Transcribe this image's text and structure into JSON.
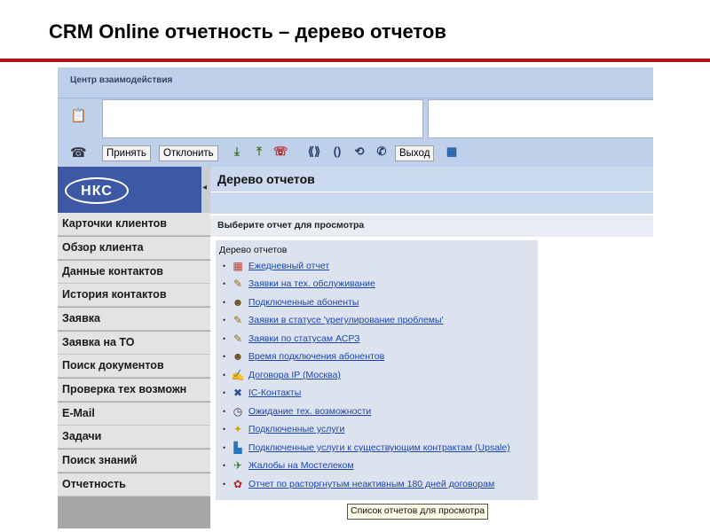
{
  "slide_title": "CRM Online отчетность – дерево отчетов",
  "app": {
    "center_title": "Центр взаимодействия",
    "toolbar": {
      "accept_label": "Принять",
      "decline_label": "Отклонить",
      "exit_label": "Выход"
    },
    "logo_text": "НКС",
    "nav_items": [
      "Карточки клиентов",
      "Обзор клиента",
      "Данные контактов",
      "История контактов",
      "Заявка",
      "Заявка на ТО",
      "Поиск документов",
      "Проверка тех возможн",
      "E-Mail",
      "Задачи",
      "Поиск знаний",
      "Отчетность"
    ],
    "page_title": "Дерево отчетов",
    "select_prompt": "Выберите отчет для просмотра",
    "tree": {
      "title": "Дерево отчетов",
      "items": [
        {
          "label": "Ежедневный отчет",
          "icon": "calendar-icon"
        },
        {
          "label": "Заявки на тех. обслуживание",
          "icon": "ticket-icon"
        },
        {
          "label": "Подключенные абоненты",
          "icon": "users-icon"
        },
        {
          "label": "Заявки в статусе 'урегулирование проблемы'",
          "icon": "ticket-icon"
        },
        {
          "label": "Заявки по статусам АСРЗ",
          "icon": "ticket-icon"
        },
        {
          "label": "Время подключения абонентов",
          "icon": "users-icon"
        },
        {
          "label": "Договора IP (Москва)",
          "icon": "contract-icon"
        },
        {
          "label": "IC-Контакты",
          "icon": "contacts-icon"
        },
        {
          "label": "Ожидание тех. возможности",
          "icon": "clock-icon"
        },
        {
          "label": "Подключенные услуги",
          "icon": "services-icon"
        },
        {
          "label": "Подключенные услуги к существующим контрактам (Upsale)",
          "icon": "services-chart-icon"
        },
        {
          "label": "Жалобы на Мостелеком",
          "icon": "complaint-icon"
        },
        {
          "label": "Отчет по расторгнутым неактивным 180 дней договорам",
          "icon": "terminated-icon"
        }
      ]
    },
    "tooltip": "Список отчетов для просмотра"
  }
}
